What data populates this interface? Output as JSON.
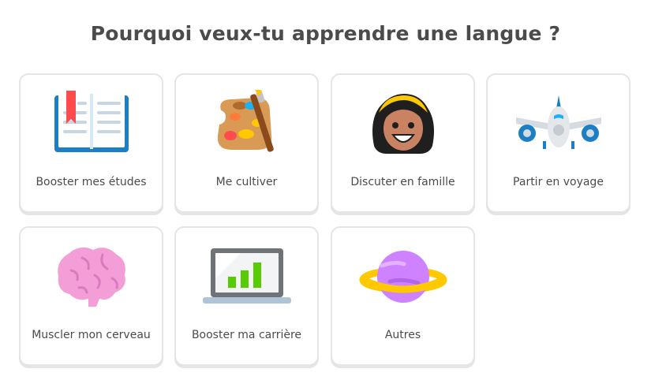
{
  "page": {
    "title": "Pourquoi veux-tu apprendre une langue ?"
  },
  "options": [
    {
      "label": "Booster mes études",
      "icon": "book-icon"
    },
    {
      "label": "Me cultiver",
      "icon": "palette-icon"
    },
    {
      "label": "Discuter en famille",
      "icon": "person-icon"
    },
    {
      "label": "Partir en voyage",
      "icon": "airplane-icon"
    },
    {
      "label": "Muscler mon cerveau",
      "icon": "brain-icon"
    },
    {
      "label": "Booster ma carrière",
      "icon": "laptop-chart-icon"
    },
    {
      "label": "Autres",
      "icon": "planet-icon"
    }
  ]
}
